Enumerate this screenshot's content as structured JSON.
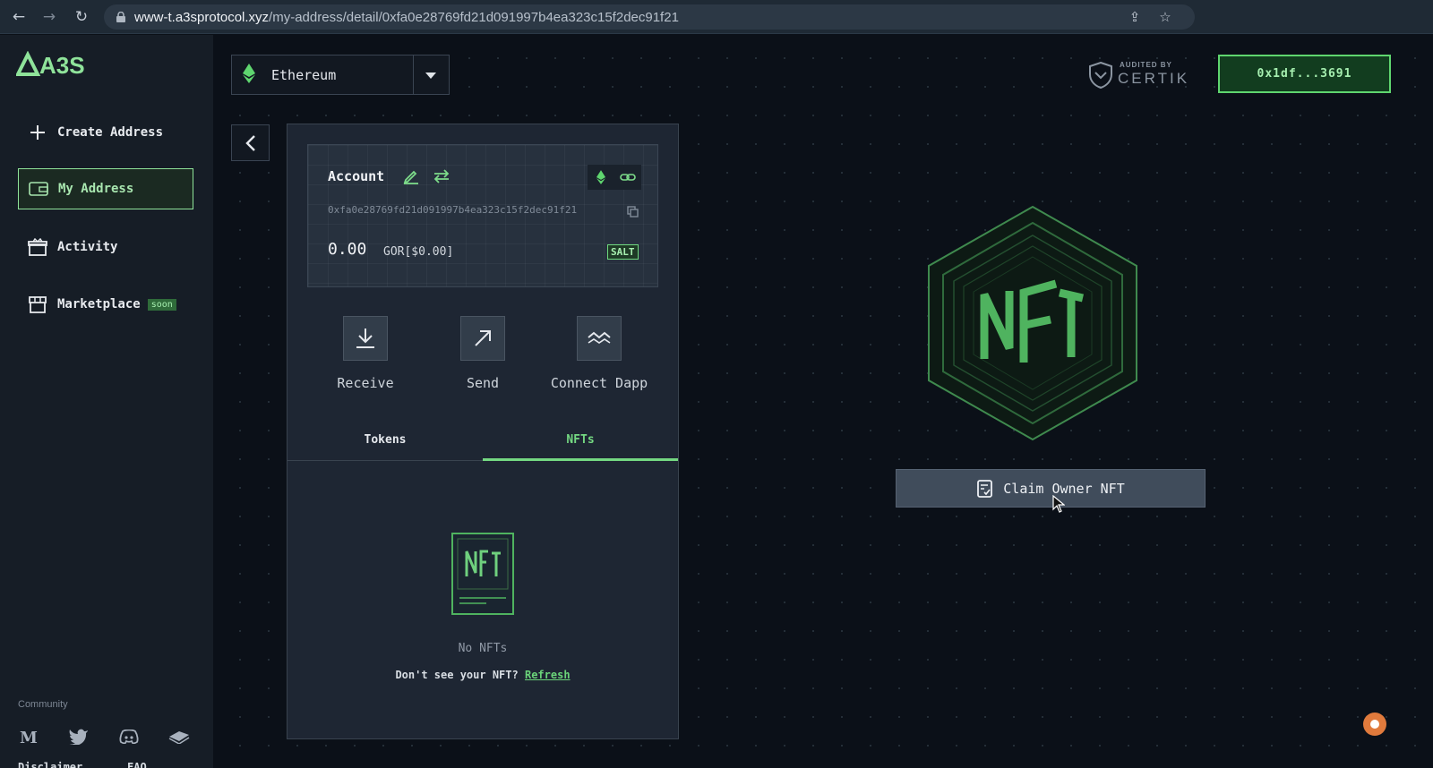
{
  "browser": {
    "url_host": "www-t.a3sprotocol.xyz",
    "url_path": "/my-address/detail/0xfa0e28769fd21d091997b4ea323c15f2dec91f21"
  },
  "sidebar": {
    "logo_text": "A3S",
    "items": [
      {
        "label": "Create Address",
        "icon": "plus-icon"
      },
      {
        "label": "My Address",
        "icon": "wallet-icon",
        "active": true
      },
      {
        "label": "Activity",
        "icon": "gift-icon"
      },
      {
        "label": "Marketplace",
        "icon": "store-icon",
        "badge": "soon"
      }
    ],
    "community_label": "Community",
    "social": [
      "medium-icon",
      "twitter-icon",
      "discord-icon",
      "gitbook-icon"
    ],
    "footer_links": [
      "Disclaimer",
      "FAQ"
    ]
  },
  "header": {
    "chain": "Ethereum",
    "certik_small": "AUDITED BY",
    "certik_big": "CERTIK",
    "wallet": "0x1df...3691"
  },
  "account": {
    "title": "Account",
    "address": "0xfa0e28769fd21d091997b4ea323c15f2dec91f21",
    "balance": "0.00",
    "unit": "GOR[$0.00]",
    "salt_badge": "SALT",
    "actions": [
      "Receive",
      "Send",
      "Connect Dapp"
    ],
    "tabs": [
      "Tokens",
      "NFTs"
    ],
    "active_tab": "NFTs",
    "empty_text": "No NFTs",
    "hint_prefix": "Don't see your NFT?",
    "hint_link": "Refresh"
  },
  "hero": {
    "claim_label": "Claim Owner NFT"
  },
  "colors": {
    "accent": "#74d882",
    "background": "#0b1018",
    "sidebar": "#161d26",
    "panel": "#1e2633"
  }
}
